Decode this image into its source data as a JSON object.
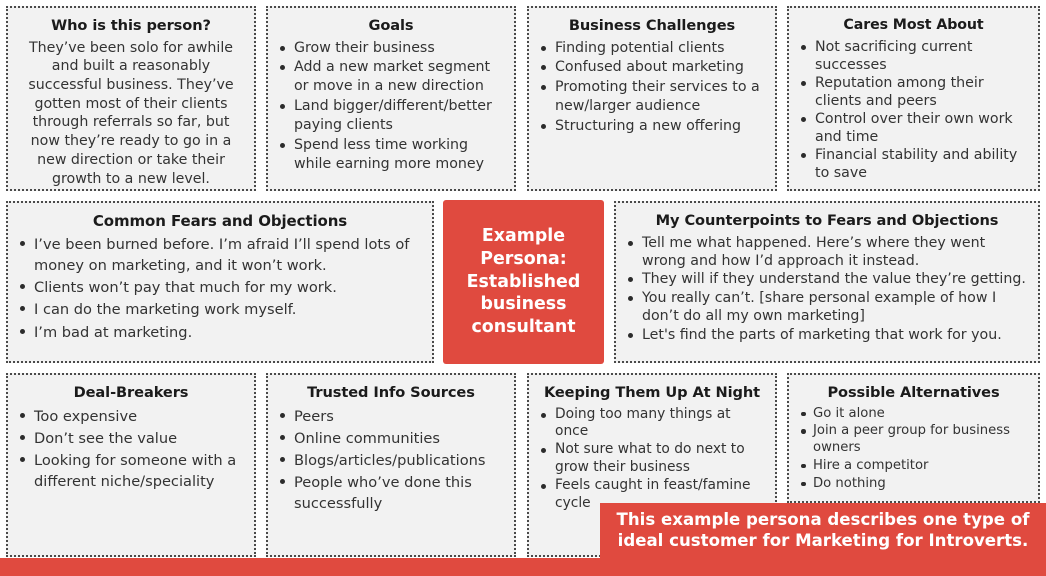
{
  "theme": {
    "accent": "#e04a3f",
    "card_bg": "#f2f2f2",
    "card_border": "#4a4a4a",
    "heading_color": "#1b1b1b",
    "body_color": "#333333"
  },
  "core": {
    "label": "Example Persona: Established business consultant"
  },
  "cards": {
    "who": {
      "title": "Who is this person?",
      "paragraph": "They’ve been solo for awhile and built a reasonably successful business. They’ve gotten most of their clients through referrals so far, but now they’re ready to go in a new direction or take their growth to a new level."
    },
    "goals": {
      "title": "Goals",
      "items": [
        "Grow their business",
        "Add a new market segment or move in a new direction",
        "Land bigger/different/better paying clients",
        "Spend less time working while earning more money"
      ]
    },
    "challenges": {
      "title": "Business Challenges",
      "items": [
        "Finding potential clients",
        "Confused about marketing",
        "Promoting their services to a new/larger audience",
        "Structuring a new offering"
      ]
    },
    "cares": {
      "title": "Cares Most About",
      "items": [
        "Not sacrificing current successes",
        "Reputation among their clients and peers",
        "Control over their own work and time",
        "Financial stability and ability to save"
      ]
    },
    "fears": {
      "title": "Common Fears and Objections",
      "items": [
        "I’ve been burned before. I’m afraid I’ll spend lots of money on marketing, and it won’t work.",
        "Clients won’t pay that much for my work.",
        "I can do the marketing work myself.",
        "I’m bad at marketing."
      ]
    },
    "counterpoints": {
      "title": "My Counterpoints to Fears and Objections",
      "items": [
        "Tell me what happened. Here’s where they went wrong and how I’d approach it instead.",
        "They will if they understand the value they’re getting.",
        "You really can’t. [share personal example of how I don’t do all my own marketing]",
        "Let's find the parts of marketing that work for you."
      ]
    },
    "dealbreakers": {
      "title": "Deal-Breakers",
      "items": [
        "Too expensive",
        "Don’t see the value",
        "Looking for someone with a different niche/speciality"
      ]
    },
    "sources": {
      "title": "Trusted Info Sources",
      "items": [
        "Peers",
        "Online communities",
        "Blogs/articles/publications",
        "People who’ve done this successfully"
      ]
    },
    "night": {
      "title": "Keeping Them Up At Night",
      "items": [
        "Doing too many things at once",
        "Not sure what to do next to grow their business",
        "Feels caught in feast/famine cycle"
      ]
    },
    "alternatives": {
      "title": "Possible Alternatives",
      "items": [
        "Go it alone",
        "Join a peer group for business owners",
        "Hire a competitor",
        "Do nothing"
      ]
    }
  },
  "footer": {
    "banner": "This example persona describes one type of ideal customer for Marketing for Introverts."
  }
}
